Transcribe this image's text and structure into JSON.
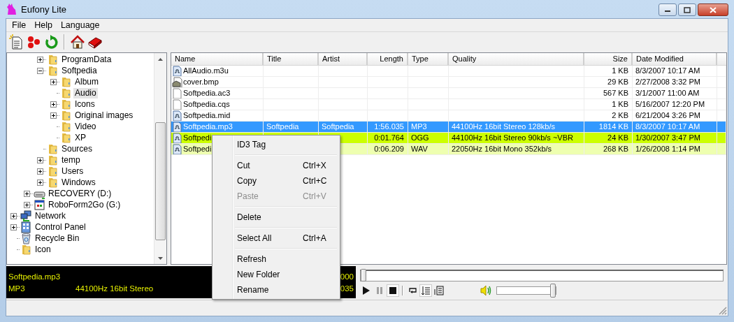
{
  "window": {
    "title": "Eufony Lite"
  },
  "menu_bar": [
    {
      "label": "File"
    },
    {
      "label": "Help"
    },
    {
      "label": "Language"
    }
  ],
  "toolbar": [
    {
      "kind": "new"
    },
    {
      "kind": "dots"
    },
    {
      "kind": "refresh"
    },
    {
      "kind": "separator"
    },
    {
      "kind": "home"
    },
    {
      "kind": "book"
    }
  ],
  "tree": {
    "items": [
      {
        "children": [
          {
            "children": [
              {
                "label": "ProgramData",
                "kind": "folder",
                "expanded": false,
                "selected": false
              },
              {
                "label": "Softpedia",
                "kind": "folder",
                "expanded": true,
                "selected": false,
                "children": [
                  {
                    "label": "Album",
                    "kind": "folder",
                    "expanded": false,
                    "selected": false
                  },
                  {
                    "label": "Audio",
                    "kind": "folder",
                    "selected": true
                  },
                  {
                    "label": "Icons",
                    "kind": "folder",
                    "expanded": false,
                    "selected": false
                  },
                  {
                    "label": "Original images",
                    "kind": "folder",
                    "expanded": false,
                    "selected": false
                  },
                  {
                    "label": "Video",
                    "kind": "folder",
                    "selected": false
                  },
                  {
                    "label": "XP",
                    "kind": "folder",
                    "selected": false
                  }
                ]
              },
              {
                "label": "Sources",
                "kind": "folder",
                "selected": false
              },
              {
                "label": "temp",
                "kind": "folder",
                "expanded": false,
                "selected": false
              },
              {
                "label": "Users",
                "kind": "folder",
                "expanded": false,
                "selected": false
              },
              {
                "label": "Windows",
                "kind": "folder",
                "expanded": false,
                "selected": false
              }
            ]
          },
          {
            "label": "RECOVERY (D:)",
            "kind": "drive",
            "expanded": false,
            "selected": false
          },
          {
            "label": "RoboForm2Go (G:)",
            "kind": "app",
            "expanded": false,
            "selected": false
          }
        ]
      },
      {
        "label": "Network",
        "kind": "network",
        "expanded": false,
        "selected": false
      },
      {
        "label": "Control Panel",
        "kind": "control-panel",
        "expanded": false,
        "selected": false
      },
      {
        "label": "Recycle Bin",
        "kind": "recycle-bin",
        "selected": false
      },
      {
        "label": "Icon",
        "kind": "folder",
        "selected": false
      }
    ]
  },
  "file_list": {
    "columns": [
      "Name",
      "Title",
      "Artist",
      "Length",
      "Type",
      "Quality",
      "Size",
      "Date Modified"
    ],
    "rows": [
      {
        "kind": "audio",
        "selected": false,
        "name": "AllAudio.m3u",
        "size": "1 KB",
        "date_modified": "8/3/2007 10:17 AM"
      },
      {
        "kind": "image",
        "selected": false,
        "name": "cover.bmp",
        "size": "29 KB",
        "date_modified": "2/27/2008 3:32 PM"
      },
      {
        "kind": "file",
        "selected": false,
        "name": "Softpedia.ac3",
        "size": "567 KB",
        "date_modified": "3/1/2007 11:00 AM"
      },
      {
        "kind": "file",
        "selected": false,
        "name": "Softpedia.cqs",
        "size": "1 KB",
        "date_modified": "5/16/2007 12:20 PM"
      },
      {
        "kind": "audio",
        "selected": false,
        "name": "Softpedia.mid",
        "size": "2 KB",
        "date_modified": "6/21/2004 3:26 PM"
      },
      {
        "kind": "audio",
        "selected": true,
        "name": "Softpedia.mp3",
        "title": "Softpedia",
        "artist": "Softpedia",
        "length": "1:56.035",
        "type": "MP3",
        "quality": "44100Hz 16bit Stereo 128kb/s",
        "size": "1814 KB",
        "date_modified": "8/3/2007 10:17 AM"
      },
      {
        "kind": "audio",
        "selected": false,
        "color": "#ccff00",
        "name": "Softpedi",
        "length": "0:01.764",
        "type": "OGG",
        "quality": "44100Hz 16bit Stereo 90kb/s ~VBR",
        "size": "24 KB",
        "date_modified": "1/30/2007 3:47 PM"
      },
      {
        "kind": "audio",
        "selected": false,
        "color": "#eeffb0",
        "name": "Softpedi",
        "length": "0:06.209",
        "type": "WAV",
        "quality": "22050Hz 16bit Mono 352kb/s",
        "size": "268 KB",
        "date_modified": "1/26/2008 1:14 PM"
      }
    ]
  },
  "player": {
    "file_name": "Softpedia.mp3",
    "type": "MP3",
    "quality": "44100Hz 16bit Stereo",
    "time_1": "000",
    "time_2": "035",
    "seek": {
      "level": 0
    },
    "buttons": [
      {
        "kind": "play",
        "disabled": false,
        "pressed": false
      },
      {
        "kind": "pause",
        "disabled": true,
        "pressed": false
      },
      {
        "kind": "stop",
        "disabled": false,
        "pressed": true
      },
      {
        "kind": "separator"
      },
      {
        "kind": "repeat",
        "disabled": false,
        "pressed": false
      },
      {
        "kind": "playlist",
        "disabled": false,
        "pressed": true
      },
      {
        "kind": "list",
        "disabled": false,
        "pressed": false
      }
    ],
    "volume": {
      "level": 1
    }
  },
  "context_menu": {
    "items": [
      {
        "kind": "item",
        "label": "ID3 Tag",
        "disabled": false
      },
      {
        "kind": "separator"
      },
      {
        "kind": "item",
        "label": "Cut",
        "shortcut": "Ctrl+X",
        "disabled": false
      },
      {
        "kind": "item",
        "label": "Copy",
        "shortcut": "Ctrl+C",
        "disabled": false
      },
      {
        "kind": "item",
        "label": "Paste",
        "shortcut": "Ctrl+V",
        "disabled": true
      },
      {
        "kind": "separator"
      },
      {
        "kind": "item",
        "label": "Delete",
        "disabled": false
      },
      {
        "kind": "separator"
      },
      {
        "kind": "item",
        "label": "Select All",
        "shortcut": "Ctrl+A",
        "disabled": false
      },
      {
        "kind": "separator"
      },
      {
        "kind": "item",
        "label": "Refresh",
        "disabled": false
      },
      {
        "kind": "item",
        "label": "New Folder",
        "disabled": false
      },
      {
        "kind": "item",
        "label": "Rename",
        "disabled": false
      }
    ]
  }
}
